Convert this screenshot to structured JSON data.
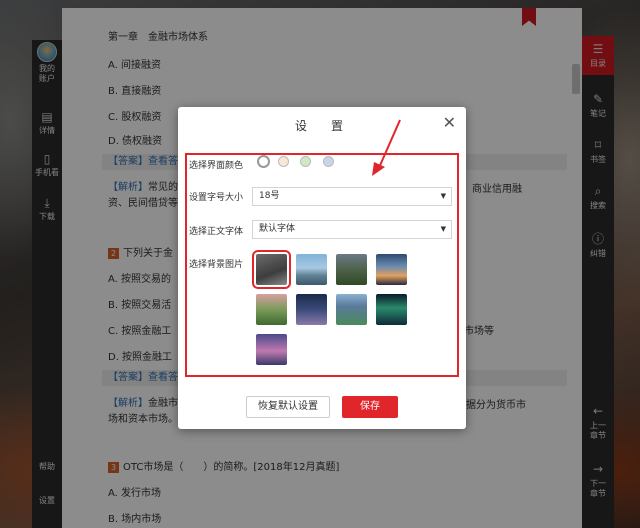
{
  "left_sidebar": {
    "items": [
      {
        "label": "我的\n账户",
        "icon": "avatar"
      },
      {
        "label": "详情",
        "icon": "document-icon"
      },
      {
        "label": "手机看",
        "icon": "phone-icon"
      },
      {
        "label": "下载",
        "icon": "download-icon"
      },
      {
        "label": "帮助",
        "icon": "help-icon"
      },
      {
        "label": "设置",
        "icon": "settings-icon"
      }
    ]
  },
  "page": {
    "chapter_title": "第一章　金融市场体系",
    "lines": [
      "A.  间接融资",
      "B.  直接融资",
      "C.  股权融资",
      "D.  债权融资"
    ],
    "answer1": "【答案】查看答",
    "analysis1_tag": "【解析】",
    "analysis1_text_a": "常见的",
    "analysis1_text_b": "商业信用融",
    "analysis1_text_c": "资、民间借贷等",
    "q2_num": "2",
    "q2_text": "下列关于金",
    "q2_options": [
      "A.  按照交易的",
      "B.  按照交易活",
      "C.  按照金融工",
      "D.  按照金融工"
    ],
    "q2_option_c_tail": "市场等",
    "answer2": "【答案】查看答",
    "analysis2_tag": "【解析】",
    "analysis2_text_a": "金融市",
    "analysis2_text_b": "据分为货币市",
    "analysis2_text_c": "场和资本市场。",
    "q3_num": "3",
    "q3_text": "OTC市场是（　　）的简称。[2018年12月真题]",
    "q3_options": [
      "A.  发行市场",
      "B.  场内市场"
    ]
  },
  "right_sidebar": {
    "items": [
      {
        "label": "目录",
        "icon": "list-icon",
        "active": true
      },
      {
        "label": "笔记",
        "icon": "pencil-icon"
      },
      {
        "label": "书签",
        "icon": "bookmark-icon"
      },
      {
        "label": "搜索",
        "icon": "search-icon"
      },
      {
        "label": "纠错",
        "icon": "alert-icon"
      },
      {
        "label": "上一\n章节",
        "icon": "prev-chapter-icon"
      },
      {
        "label": "下一\n章节",
        "icon": "next-chapter-icon"
      }
    ]
  },
  "dialog": {
    "title": "设　置",
    "labels": {
      "theme_color": "选择界面颜色",
      "font_size": "设置字号大小",
      "font_family": "选择正文字体",
      "background": "选择背景图片"
    },
    "theme_colors": [
      "#ffffff",
      "#f7e8d8",
      "#cfe8c8",
      "#c8d4ea"
    ],
    "font_size_value": "18号",
    "font_family_value": "默认字体",
    "reset_button": "恢复默认设置",
    "save_button": "保存"
  },
  "colors": {
    "accent": "#e0262b",
    "link": "#2f6fb3"
  }
}
